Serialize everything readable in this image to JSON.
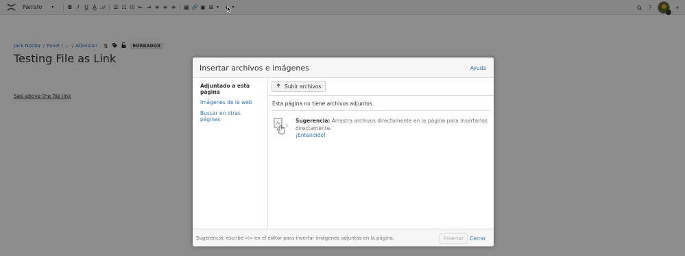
{
  "toolbar": {
    "format_label": "Párrafo",
    "buttons": [
      "B",
      "I",
      "U",
      "A",
      "𝒜",
      "☰",
      "☷",
      "☑",
      "⇤",
      "⇥",
      "≡",
      "≡",
      "≡",
      "▦",
      "🔗",
      "▣",
      "⊞",
      "+"
    ],
    "right_buttons": [
      "🔍",
      "?"
    ],
    "add_label": "+"
  },
  "breadcrumb": {
    "items": [
      "Jack Noldor",
      "Panel",
      "...",
      "Atlassian"
    ],
    "separator": "/",
    "status_badge": "BORRADOR"
  },
  "page": {
    "title": "Testing File as Link",
    "body_link": "See above the file link"
  },
  "dialog": {
    "title": "Insertar archivos e imágenes",
    "help_label": "Ayuda",
    "nav": {
      "items": [
        {
          "label": "Adjuntado a esta página",
          "active": true
        },
        {
          "label": "Imágenes de la web",
          "active": false
        },
        {
          "label": "Buscar en otras páginas",
          "active": false
        }
      ]
    },
    "upload_label": "Subir archivos",
    "no_files_text": "Esta página no tiene archivos adjuntos.",
    "tip": {
      "title": "Sugerencia:",
      "text": "Arrastra archivos directamente en la página para insertarlos directamente.",
      "link": "¡Entendido!"
    },
    "footer": {
      "hint": "Sugerencia: escribe «!» en el editor para insertar imágenes adjuntas en la página.",
      "insert_label": "Insertar",
      "close_label": "Cerrar"
    }
  },
  "colors": {
    "link": "#3572b0",
    "overlay": "rgba(0,0,0,0.45)"
  }
}
